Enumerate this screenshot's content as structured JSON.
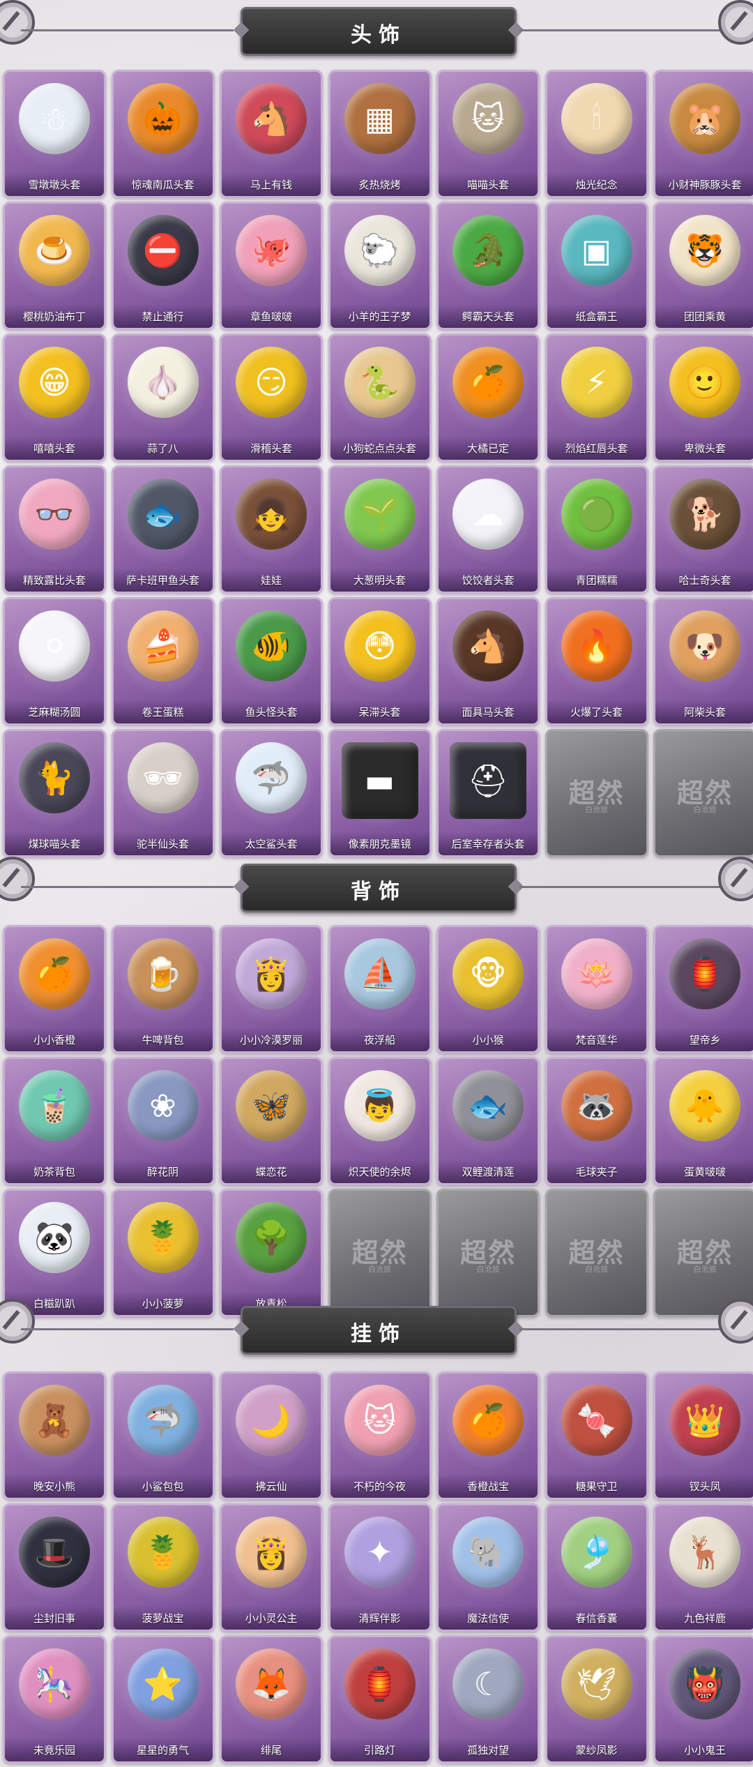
{
  "sections": [
    {
      "title": "头饰",
      "items": [
        {
          "label": "雪墩墩头套",
          "color": "#e8eef5",
          "icon": "☃"
        },
        {
          "label": "惊魂南瓜头套",
          "color": "#e98a2a",
          "icon": "🎃"
        },
        {
          "label": "马上有钱",
          "color": "#d04a5a",
          "icon": "🐴"
        },
        {
          "label": "炙热烧烤",
          "color": "#b07040",
          "icon": "▦"
        },
        {
          "label": "喵喵头套",
          "color": "#b8a890",
          "icon": "🐱"
        },
        {
          "label": "烛光纪念",
          "color": "#f0d8b0",
          "icon": "🕯"
        },
        {
          "label": "小财神豚豚头套",
          "color": "#c88a40",
          "icon": "🐹"
        },
        {
          "label": "樱桃奶油布丁",
          "color": "#f2b850",
          "icon": "🍮"
        },
        {
          "label": "禁止通行",
          "color": "#3a3a48",
          "icon": "⛔"
        },
        {
          "label": "章鱼啵啵",
          "color": "#f0a0b8",
          "icon": "🐙"
        },
        {
          "label": "小羊的王子梦",
          "color": "#eae6dc",
          "icon": "🐑"
        },
        {
          "label": "鳄霸天头套",
          "color": "#4caa44",
          "icon": "🐊"
        },
        {
          "label": "纸盒霸王",
          "color": "#5ab8c0",
          "icon": "▣"
        },
        {
          "label": "团团乘黄",
          "color": "#f2e4c8",
          "icon": "🐯"
        },
        {
          "label": "嘻嘻头套",
          "color": "#f4c020",
          "icon": "😁"
        },
        {
          "label": "蒜了八",
          "color": "#f4f0e0",
          "icon": "🧄"
        },
        {
          "label": "滑稽头套",
          "color": "#f0c020",
          "icon": "😏"
        },
        {
          "label": "小狗蛇点点头套",
          "color": "#e8c890",
          "icon": "🐍"
        },
        {
          "label": "大橘已定",
          "color": "#f09020",
          "icon": "🍊"
        },
        {
          "label": "烈焰红唇头套",
          "color": "#f0d040",
          "icon": "⚡"
        },
        {
          "label": "卑微头套",
          "color": "#f4c020",
          "icon": "🙂"
        },
        {
          "label": "精致露比头套",
          "color": "#f0a8c0",
          "icon": "👓"
        },
        {
          "label": "萨卡班甲鱼头套",
          "color": "#505868",
          "icon": "🐟"
        },
        {
          "label": "娃娃",
          "color": "#7a5038",
          "icon": "👧"
        },
        {
          "label": "大葱明头套",
          "color": "#80c850",
          "icon": "🌱"
        },
        {
          "label": "饺饺者头套",
          "color": "#f2f2f8",
          "icon": "☁"
        },
        {
          "label": "青团糯糯",
          "color": "#70c040",
          "icon": "🟢"
        },
        {
          "label": "哈士奇头套",
          "color": "#6a5038",
          "icon": "🐕"
        },
        {
          "label": "芝麻糊汤圆",
          "color": "#f6f6fa",
          "icon": "⚪"
        },
        {
          "label": "卷王蛋糕",
          "color": "#f0b070",
          "icon": "🍰"
        },
        {
          "label": "鱼头怪头套",
          "color": "#4a9a4a",
          "icon": "🐠"
        },
        {
          "label": "呆滞头套",
          "color": "#f4c020",
          "icon": "😳"
        },
        {
          "label": "面具马头套",
          "color": "#5a3828",
          "icon": "🐴"
        },
        {
          "label": "火爆了头套",
          "color": "#f07020",
          "icon": "🔥"
        },
        {
          "label": "阿柴头套",
          "color": "#e0a060",
          "icon": "🐶"
        },
        {
          "label": "煤球喵头套",
          "color": "#4a4858",
          "icon": "🐈"
        },
        {
          "label": "驼半仙头套",
          "color": "#d8d0c8",
          "icon": "🕶"
        },
        {
          "label": "太空鲨头套",
          "color": "#e0ecf8",
          "icon": "🦈"
        },
        {
          "label": "像素朋克墨镜",
          "color": "#2a2a2a",
          "icon": "▬",
          "locked_style": true
        },
        {
          "label": "后室幸存者头套",
          "color": "#303038",
          "icon": "⛑",
          "locked_style": true
        },
        {
          "label": "",
          "locked": true
        },
        {
          "label": "",
          "locked": true
        }
      ]
    },
    {
      "title": "背饰",
      "items": [
        {
          "label": "小小香橙",
          "color": "#f09030",
          "icon": "🍊"
        },
        {
          "label": "牛啤背包",
          "color": "#c8905a",
          "icon": "🍺"
        },
        {
          "label": "小小冷漠罗丽",
          "color": "#c0a8d8",
          "icon": "👸"
        },
        {
          "label": "夜浮船",
          "color": "#a8c8e0",
          "icon": "⛵"
        },
        {
          "label": "小小猴",
          "color": "#e8c030",
          "icon": "🐵"
        },
        {
          "label": "梵音莲华",
          "color": "#f0b0c8",
          "icon": "🪷"
        },
        {
          "label": "望帝乡",
          "color": "#5a4860",
          "icon": "🏮"
        },
        {
          "label": "奶茶背包",
          "color": "#70c8b0",
          "icon": "🧋"
        },
        {
          "label": "醉花阴",
          "color": "#8898c0",
          "icon": "❀"
        },
        {
          "label": "蝶恋花",
          "color": "#d0a860",
          "icon": "🦋"
        },
        {
          "label": "炽天使的余烬",
          "color": "#f0e8e0",
          "icon": "👼"
        },
        {
          "label": "双鲤渡清莲",
          "color": "#909098",
          "icon": "🐟"
        },
        {
          "label": "毛球夹子",
          "color": "#d07040",
          "icon": "🦝"
        },
        {
          "label": "蛋黄啵啵",
          "color": "#f4d040",
          "icon": "🐥"
        },
        {
          "label": "白糍趴趴",
          "color": "#e8eef4",
          "icon": "🐼"
        },
        {
          "label": "小小菠萝",
          "color": "#e8c030",
          "icon": "🍍"
        },
        {
          "label": "放青松",
          "color": "#58a040",
          "icon": "🌳"
        },
        {
          "label": "",
          "locked": true
        },
        {
          "label": "",
          "locked": true
        },
        {
          "label": "",
          "locked": true
        },
        {
          "label": "",
          "locked": true
        }
      ]
    },
    {
      "title": "挂饰",
      "items": [
        {
          "label": "晚安小熊",
          "color": "#c89060",
          "icon": "🧸"
        },
        {
          "label": "小鲨包包",
          "color": "#80b0e0",
          "icon": "🦈"
        },
        {
          "label": "拂云仙",
          "color": "#d0a0c8",
          "icon": "🌙"
        },
        {
          "label": "不朽的今夜",
          "color": "#f0a0b0",
          "icon": "🐱"
        },
        {
          "label": "香橙战宝",
          "color": "#f08030",
          "icon": "🍊"
        },
        {
          "label": "糖果守卫",
          "color": "#c05040",
          "icon": "🍬"
        },
        {
          "label": "钗头凤",
          "color": "#c04050",
          "icon": "👑"
        },
        {
          "label": "尘封旧事",
          "color": "#303040",
          "icon": "🎩"
        },
        {
          "label": "菠萝战宝",
          "color": "#d8c030",
          "icon": "🍍"
        },
        {
          "label": "小小灵公主",
          "color": "#f0c090",
          "icon": "👸"
        },
        {
          "label": "清辉伴影",
          "color": "#b0a0e0",
          "icon": "✦"
        },
        {
          "label": "魔法信使",
          "color": "#a0c0e8",
          "icon": "🐘"
        },
        {
          "label": "春信香囊",
          "color": "#a0d080",
          "icon": "🎐"
        },
        {
          "label": "九色祥鹿",
          "color": "#e8e0d0",
          "icon": "🦌"
        },
        {
          "label": "未竟乐园",
          "color": "#e090c0",
          "icon": "🎠"
        },
        {
          "label": "星星的勇气",
          "color": "#80a0e0",
          "icon": "⭐"
        },
        {
          "label": "绯尾",
          "color": "#e89080",
          "icon": "🦊"
        },
        {
          "label": "引路灯",
          "color": "#c04040",
          "icon": "🏮"
        },
        {
          "label": "孤独对望",
          "color": "#a0a8c0",
          "icon": "☾"
        },
        {
          "label": "蒙纱凤影",
          "color": "#d0b060",
          "icon": "🕊"
        },
        {
          "label": "小小鬼王",
          "color": "#605878",
          "icon": "👹"
        }
      ]
    }
  ],
  "locked_card": {
    "title": "超然",
    "subtitle": "白沧旅"
  }
}
